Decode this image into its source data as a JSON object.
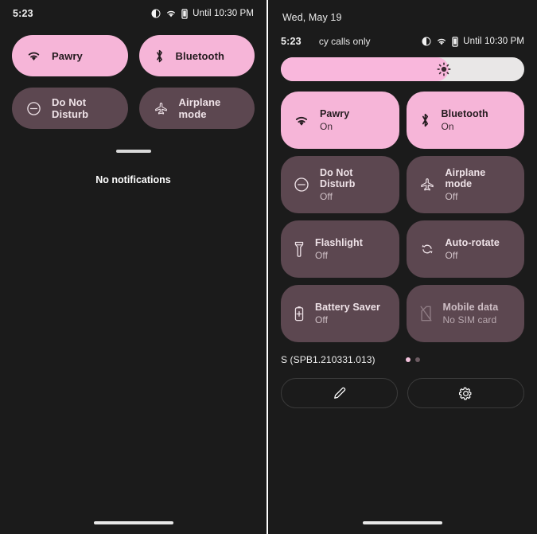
{
  "colors": {
    "background": "#1b1b1b",
    "tile_active_bg": "#f6b5d8",
    "tile_inactive_bg": "#5c4750",
    "accent_pink": "#f9b7dc",
    "text_primary": "#ffffff"
  },
  "left_panel": {
    "statusbar": {
      "clock": "5:23",
      "icons": [
        "dnd-icon",
        "wifi-icon",
        "vibrate-icon"
      ],
      "until_text": "Until 10:30 PM"
    },
    "tiles": [
      {
        "label": "Pawry",
        "icon": "wifi-icon",
        "state": "on"
      },
      {
        "label": "Bluetooth",
        "icon": "bluetooth-icon",
        "state": "on"
      },
      {
        "label": "Do Not Disturb",
        "icon": "dnd-icon",
        "state": "off"
      },
      {
        "label": "Airplane mode",
        "icon": "airplane-icon",
        "state": "off"
      }
    ],
    "notifications_empty_text": "No notifications"
  },
  "right_panel": {
    "date": "Wed, May 19",
    "statusbar": {
      "clock": "5:23",
      "carrier": "cy calls only",
      "icons": [
        "dnd-icon",
        "wifi-icon",
        "vibrate-icon"
      ],
      "until_text": "Until 10:30 PM"
    },
    "brightness": {
      "icon": "brightness-icon",
      "level_percent": 69
    },
    "tiles": [
      {
        "label": "Pawry",
        "state": "On",
        "icon": "wifi-icon",
        "status": "active"
      },
      {
        "label": "Bluetooth",
        "state": "On",
        "icon": "bluetooth-icon",
        "status": "active"
      },
      {
        "label": "Do Not Disturb",
        "state": "Off",
        "icon": "dnd-icon",
        "status": "inactive"
      },
      {
        "label": "Airplane mode",
        "state": "Off",
        "icon": "airplane-icon",
        "status": "inactive"
      },
      {
        "label": "Flashlight",
        "state": "Off",
        "icon": "flashlight-icon",
        "status": "inactive"
      },
      {
        "label": "Auto-rotate",
        "state": "Off",
        "icon": "auto-rotate-icon",
        "status": "inactive"
      },
      {
        "label": "Battery Saver",
        "state": "Off",
        "icon": "battery-saver-icon",
        "status": "inactive"
      },
      {
        "label": "Mobile data",
        "state": "No SIM card",
        "icon": "no-sim-icon",
        "status": "disabled"
      }
    ],
    "footer": {
      "build": "S (SPB1.210331.013)",
      "pages": 2,
      "active_page": 1,
      "edit_icon": "pencil-icon",
      "settings_icon": "gear-icon"
    }
  }
}
